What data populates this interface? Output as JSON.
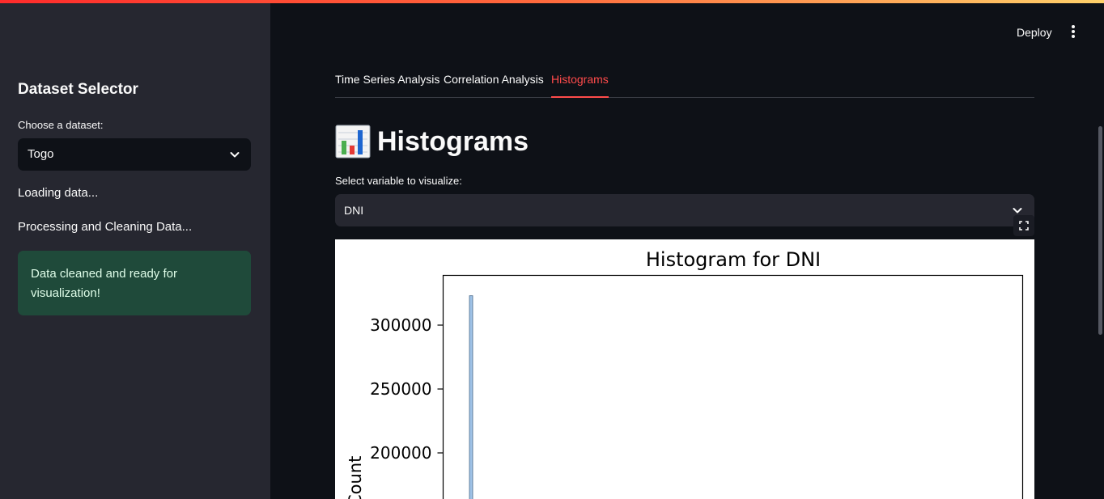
{
  "sidebar": {
    "title": "Dataset Selector",
    "dataset_label": "Choose a dataset:",
    "dataset_value": "Togo",
    "status_loading": "Loading data...",
    "status_processing": "Processing and Cleaning Data...",
    "success_message": "Data cleaned and ready for visualization!"
  },
  "header": {
    "deploy_label": "Deploy",
    "menu_icon": "vertical-dots-icon"
  },
  "tabs": [
    {
      "label": "Time Series Analysis",
      "active": false
    },
    {
      "label": "Correlation Analysis",
      "active": false
    },
    {
      "label": "Histograms",
      "active": true
    }
  ],
  "main": {
    "heading": "Histograms",
    "heading_icon": "bar-chart-icon",
    "variable_label": "Select variable to visualize:",
    "variable_value": "DNI"
  },
  "colors": {
    "accent": "#ff4b4b",
    "sidebar_bg": "#262730",
    "main_bg": "#0e1117",
    "success_bg": "#1f4a3a",
    "bar_fill": "#9fc2e7",
    "bar_edge": "#4a6b8c"
  },
  "chart_data": {
    "type": "bar",
    "title": "Histogram for DNI",
    "ylabel": "Count",
    "xlabel": "",
    "yticks": [
      200000,
      250000,
      300000
    ],
    "ytick_labels": [
      "200000",
      "250000",
      "300000"
    ],
    "values": [
      323000
    ],
    "ylim_visible": [
      160000,
      340000
    ]
  }
}
